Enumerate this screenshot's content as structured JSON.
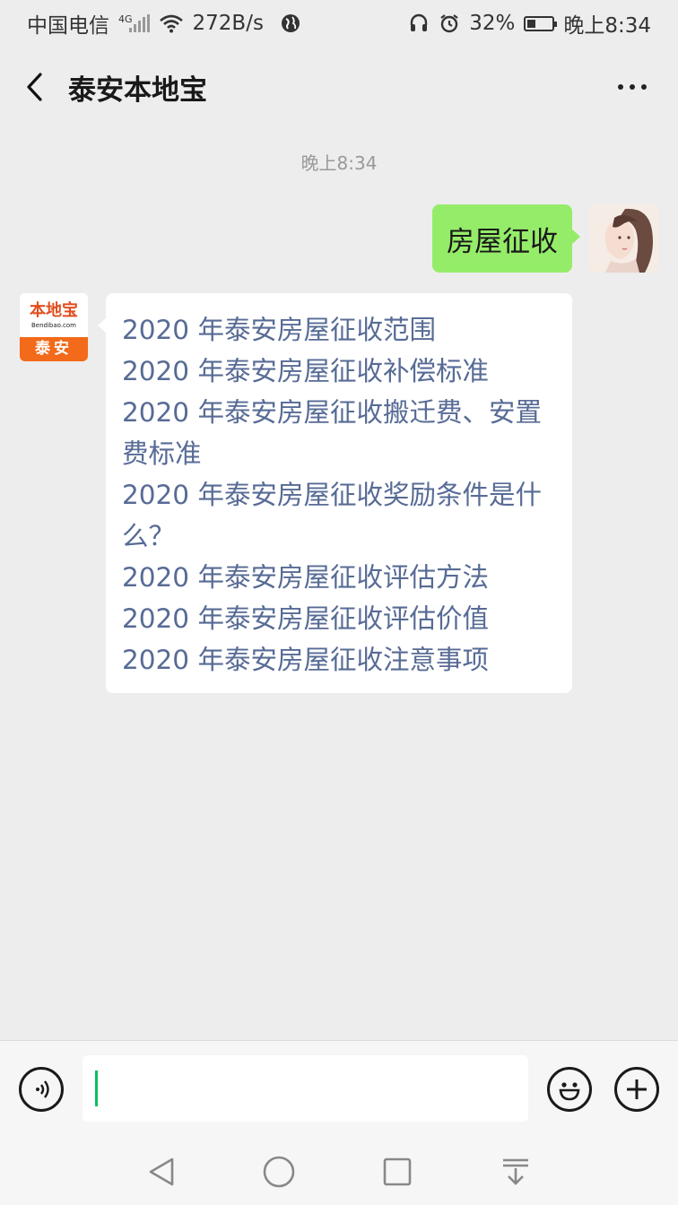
{
  "status_bar": {
    "carrier": "中国电信",
    "network": "4G",
    "speed": "272B/s",
    "battery": "32%",
    "time": "晚上8:34",
    "battery_level": 0.32
  },
  "header": {
    "title": "泰安本地宝"
  },
  "chat": {
    "timestamp": "晚上8:34",
    "user_message": "房屋征收",
    "bot_avatar": {
      "brand": "本地宝",
      "url": "Bendibao.com",
      "city": "泰安"
    },
    "bot_links": [
      "2020 年泰安房屋征收范围",
      "2020 年泰安房屋征收补偿标准",
      "2020 年泰安房屋征收搬迁费、安置费标准",
      "2020 年泰安房屋征收奖励条件是什么？",
      "2020 年泰安房屋征收评估方法",
      "2020 年泰安房屋征收评估价值",
      "2020 年泰安房屋征收注意事项"
    ]
  },
  "input_bar": {
    "text_value": ""
  },
  "colors": {
    "user_bubble": "#95ec69",
    "link": "#576b95",
    "background": "#ededed",
    "caret": "#07c160",
    "brand_orange": "#f26a1a"
  }
}
